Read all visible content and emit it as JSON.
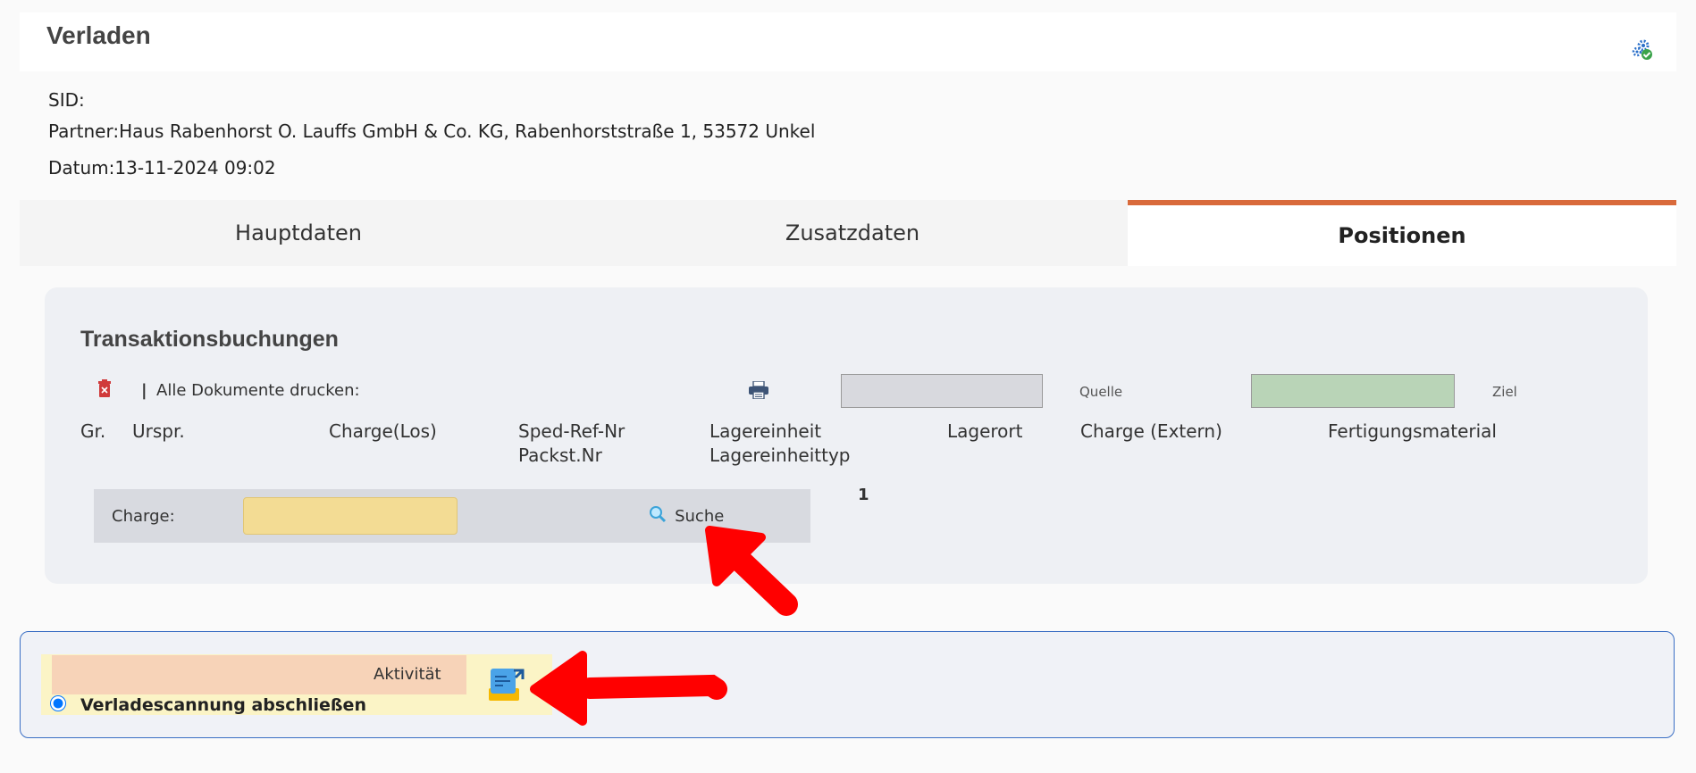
{
  "header": {
    "title": "Verladen",
    "settings_icon": "gears-check-icon"
  },
  "info": {
    "sid": "SID:",
    "partner": "Partner:Haus Rabenhorst O. Lauffs GmbH & Co. KG, Rabenhorststraße 1, 53572 Unkel",
    "datum": "Datum:13-11-2024 09:02"
  },
  "tabs": [
    {
      "label": "Hauptdaten",
      "active": false
    },
    {
      "label": "Zusatzdaten",
      "active": false
    },
    {
      "label": "Positionen",
      "active": true
    }
  ],
  "colors": {
    "accent": "#d96a3b",
    "charge_input": "#f3dc94",
    "ziel": "#b9d4b7",
    "quelle": "#d8d9de",
    "activity_border": "#3b6fc4"
  },
  "panel": {
    "title": "Transaktionsbuchungen",
    "toolbar": {
      "delete_icon": "trash-icon",
      "separator": "|",
      "print_all_label": "Alle Dokumente drucken:",
      "print_icon": "printer-icon",
      "quelle_label": "Quelle",
      "ziel_label": "Ziel"
    },
    "columns": {
      "gr": "Gr.",
      "urspr": "Urspr.",
      "charge_los": "Charge(Los)",
      "sped_ref": "Sped-Ref-Nr",
      "packst": "Packst.Nr",
      "lagereinheit": "Lagereinheit",
      "lagereinheittyp": "Lagereinheittyp",
      "lagerort": "Lagerort",
      "charge_extern": "Charge (Extern)",
      "fertigungsmaterial": "Fertigungsmaterial"
    },
    "charge_search": {
      "label": "Charge:",
      "value": "",
      "search_icon": "magnifier-icon",
      "search_label": "Suche"
    },
    "count": "1"
  },
  "activity": {
    "label": "Aktivität",
    "option_label": "Verladescannung abschließen",
    "selected": true,
    "icon": "document-tray-icon"
  }
}
